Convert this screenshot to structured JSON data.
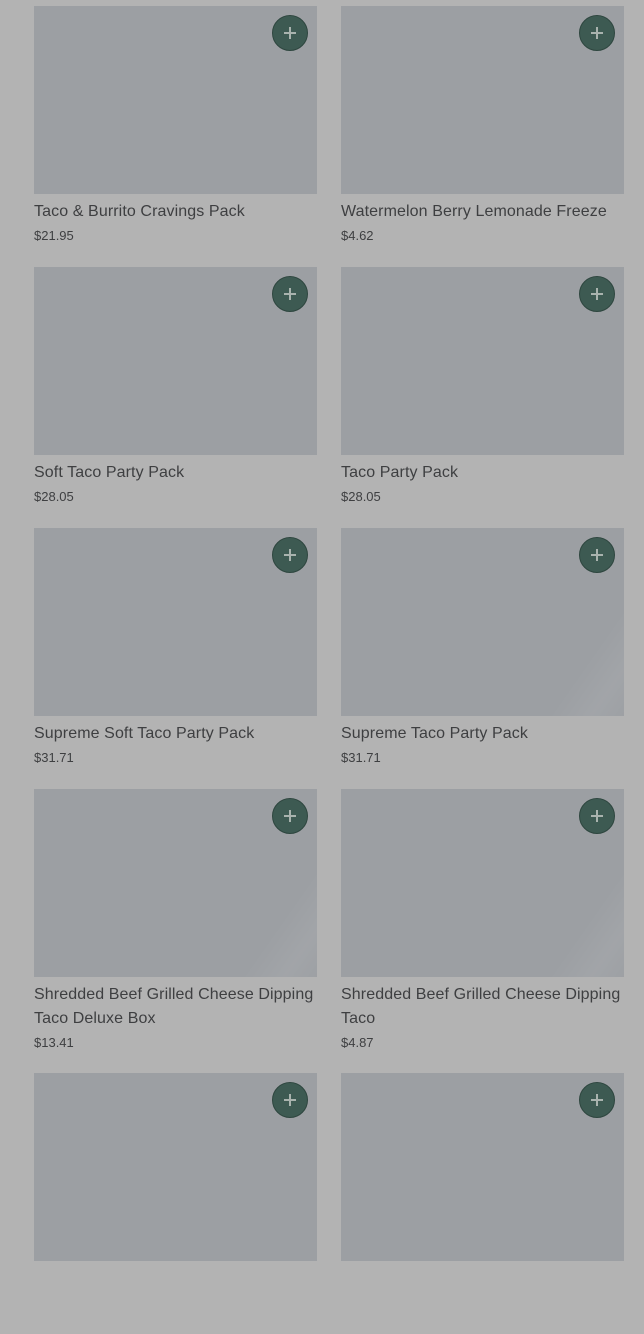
{
  "products": [
    {
      "name": "Taco & Burrito Cravings Pack",
      "price": "$21.95"
    },
    {
      "name": "Watermelon Berry Lemonade Freeze",
      "price": "$4.62"
    },
    {
      "name": "Soft Taco Party Pack",
      "price": "$28.05"
    },
    {
      "name": "Taco Party Pack",
      "price": "$28.05"
    },
    {
      "name": "Supreme Soft Taco Party Pack",
      "price": "$31.71"
    },
    {
      "name": "Supreme Taco Party Pack",
      "price": "$31.71"
    },
    {
      "name": "Shredded Beef Grilled Cheese Dipping Taco Deluxe Box",
      "price": "$13.41"
    },
    {
      "name": "Shredded Beef Grilled Cheese Dipping Taco",
      "price": "$4.87"
    },
    {
      "name": "",
      "price": ""
    },
    {
      "name": "",
      "price": ""
    }
  ],
  "colors": {
    "overlay_background": "#b3b3b3",
    "image_placeholder": "#9c9fa3",
    "add_button": "#3d5a52",
    "text": "#3e3f41"
  }
}
